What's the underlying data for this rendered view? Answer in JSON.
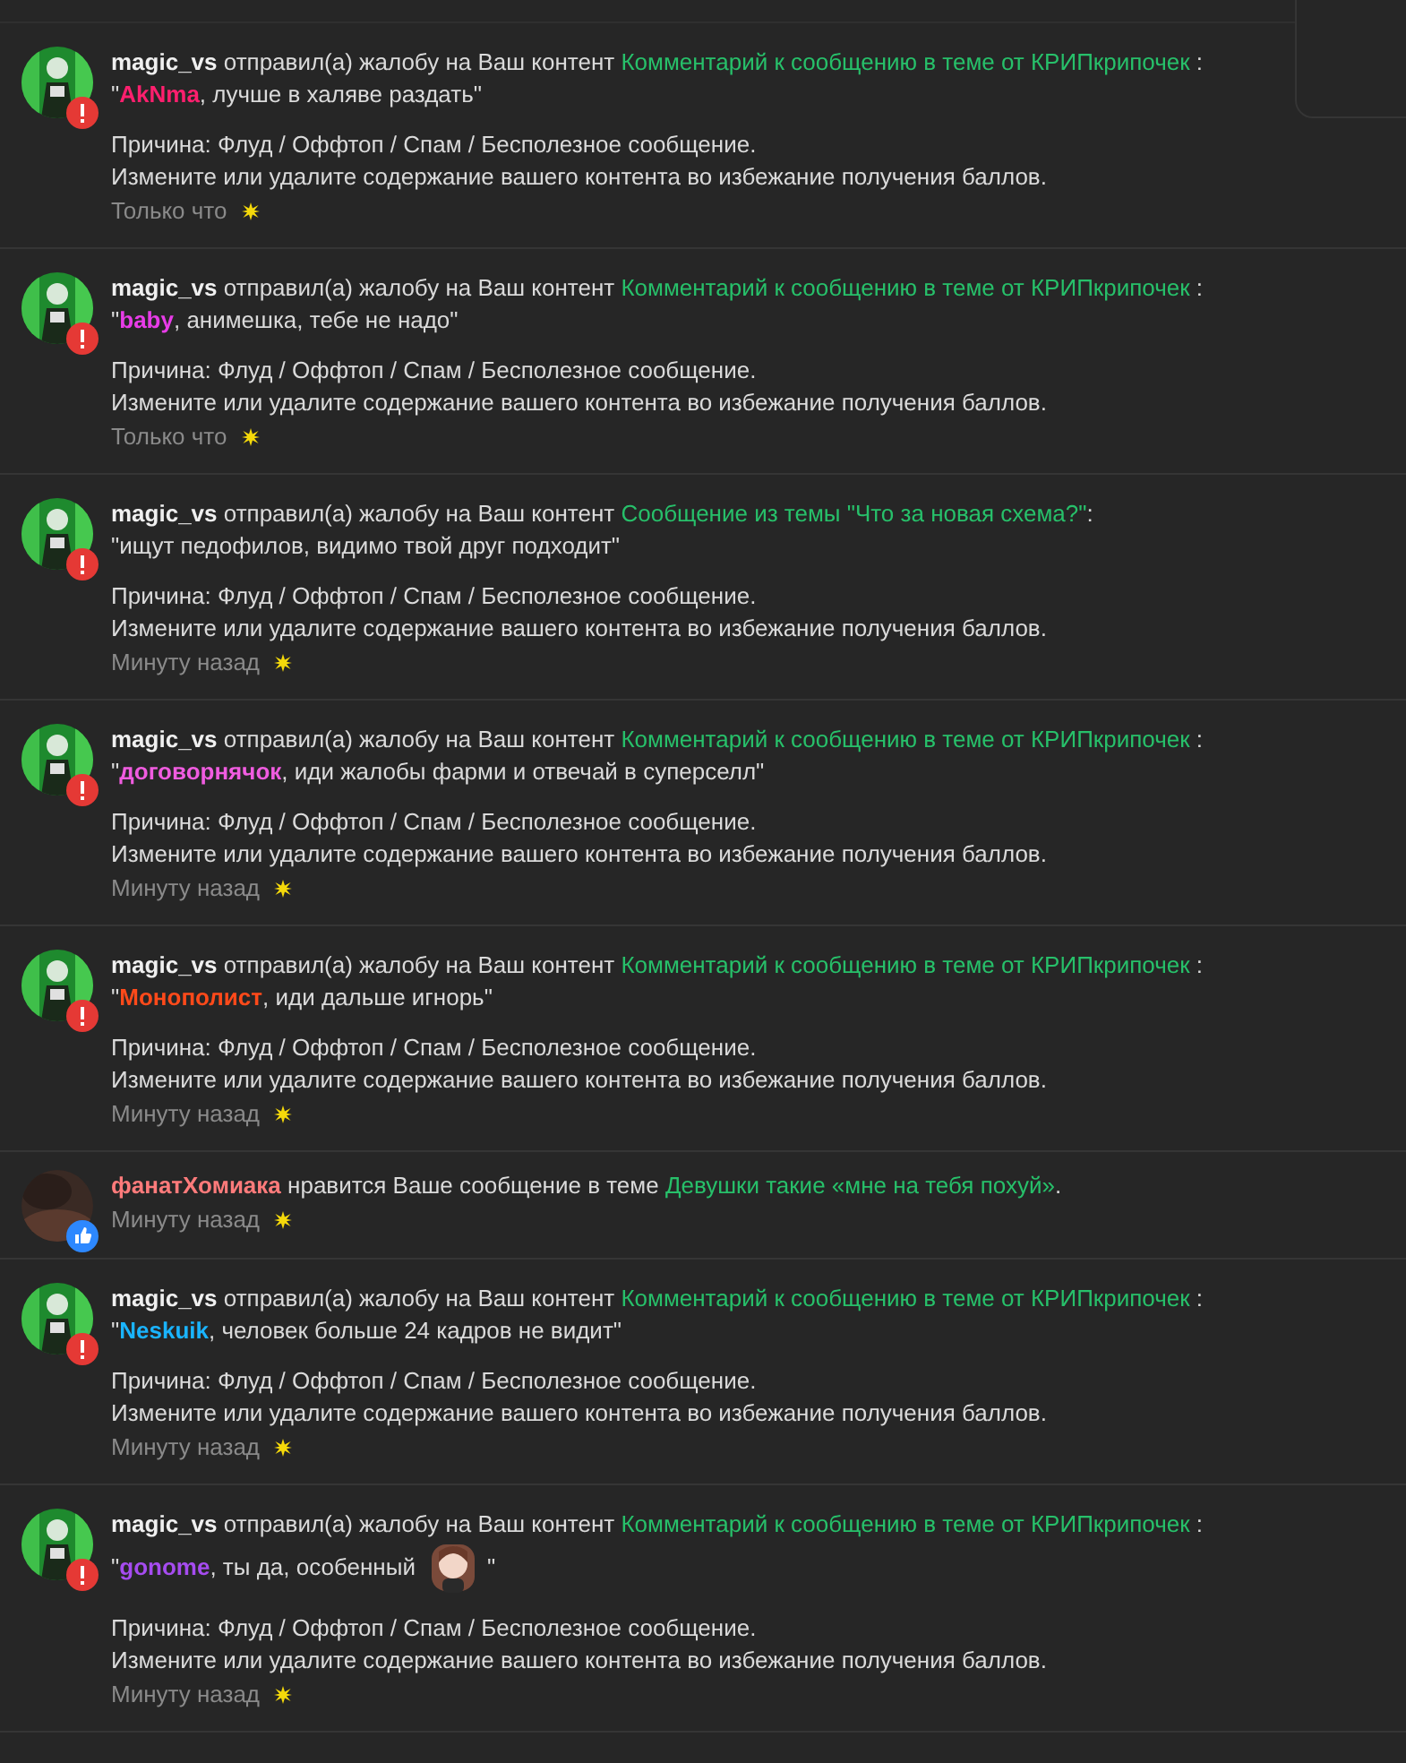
{
  "notifications": [
    {
      "kind": "report",
      "actor": "magic_vs",
      "action": "отправил(а) жалобу на Ваш контент",
      "link": "Комментарий к сообщению в теме от КРИПкрипочек",
      "link_suffix": " :",
      "quote_open": "\"",
      "quote_user": "AkNma",
      "color": "#ff1f6e",
      "quote_text": ", лучше в халяве раздать\"",
      "reason": "Причина: Флуд / Оффтоп / Спам / Бесполезное сообщение.",
      "advice": "Измените или удалите содержание вашего контента во избежание получения баллов.",
      "time": "Только что"
    },
    {
      "kind": "report",
      "actor": "magic_vs",
      "action": "отправил(а) жалобу на Ваш контент",
      "link": "Комментарий к сообщению в теме от КРИПкрипочек",
      "link_suffix": " :",
      "quote_open": "\"",
      "quote_user": "baby",
      "color": "#e83ce8",
      "quote_text": ", анимешка, тебе не надо\"",
      "reason": "Причина: Флуд / Оффтоп / Спам / Бесполезное сообщение.",
      "advice": "Измените или удалите содержание вашего контента во избежание получения баллов.",
      "time": "Только что"
    },
    {
      "kind": "report",
      "actor": "magic_vs",
      "action": "отправил(а) жалобу на Ваш контент",
      "link": "Сообщение из темы \"Что за новая схема?\"",
      "link_suffix": ":",
      "quote_text": "\"ищут педофилов, видимо твой друг подходит\"",
      "reason": "Причина: Флуд / Оффтоп / Спам / Бесполезное сообщение.",
      "advice": "Измените или удалите содержание вашего контента во избежание получения баллов.",
      "time": "Минуту назад"
    },
    {
      "kind": "report",
      "actor": "magic_vs",
      "action": "отправил(а) жалобу на Ваш контент",
      "link": "Комментарий к сообщению в теме от КРИПкрипочек",
      "link_suffix": " :",
      "quote_open": "\"",
      "quote_user": "договорнячок",
      "color": "#f05ce0",
      "quote_text": ", иди жалобы фарми и отвечай в суперселл\"",
      "reason": "Причина: Флуд / Оффтоп / Спам / Бесполезное сообщение.",
      "advice": "Измените или удалите содержание вашего контента во избежание получения баллов.",
      "time": "Минуту назад"
    },
    {
      "kind": "report",
      "actor": "magic_vs",
      "action": "отправил(а) жалобу на Ваш контент",
      "link": "Комментарий к сообщению в теме от КРИПкрипочек",
      "link_suffix": " :",
      "quote_open": "\"",
      "quote_user": "Монополист",
      "color": "#ff4a1a",
      "quote_text": ", иди дальше игнорь\"",
      "reason": "Причина: Флуд / Оффтоп / Спам / Бесполезное сообщение.",
      "advice": "Измените или удалите содержание вашего контента во избежание получения баллов.",
      "time": "Минуту назад"
    },
    {
      "kind": "like",
      "actor": "фанатХомиака",
      "action": "нравится Ваше сообщение в теме",
      "link": "Девушки такие «мне на тебя похуй»",
      "link_suffix": ".",
      "time": "Минуту назад"
    },
    {
      "kind": "report",
      "actor": "magic_vs",
      "action": "отправил(а) жалобу на Ваш контент",
      "link": "Комментарий к сообщению в теме от КРИПкрипочек",
      "link_suffix": " :",
      "quote_open": "\"",
      "quote_user": "Neskuik",
      "color": "#1ab4ff",
      "quote_text": ", человек больше 24 кадров не видит\"",
      "reason": "Причина: Флуд / Оффтоп / Спам / Бесполезное сообщение.",
      "advice": "Измените или удалите содержание вашего контента во избежание получения баллов.",
      "time": "Минуту назад"
    },
    {
      "kind": "report",
      "actor": "magic_vs",
      "action": "отправил(а) жалобу на Ваш контент",
      "link": "Комментарий к сообщению в теме от КРИПкрипочек",
      "link_suffix": " :",
      "quote_open": "\"",
      "quote_user": "gonome",
      "color": "#a64cf0",
      "quote_text": ", ты да, особенный",
      "sticker": true,
      "quote_end": "\"",
      "reason": "Причина: Флуд / Оффтоп / Спам / Бесполезное сообщение.",
      "advice": "Измените или удалите содержание вашего контента во избежание получения баллов.",
      "time": "Минуту назад"
    }
  ]
}
